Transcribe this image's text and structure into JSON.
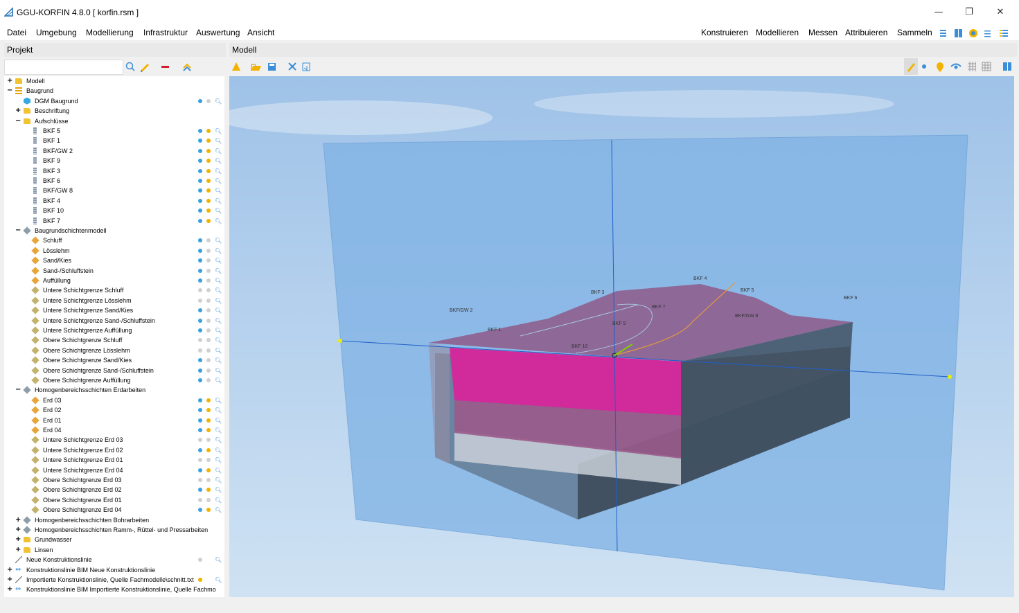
{
  "window": {
    "title": "GGU-KORFIN 4.8.0 [ korfin.rsm ]",
    "minimize": "—",
    "restore": "❐",
    "close": "✕",
    "accent": "#3a8fd8"
  },
  "menu": {
    "left": [
      "Datei",
      "Umgebung",
      "Modellierung",
      "Infrastruktur",
      "Auswertung",
      "Ansicht"
    ],
    "right": [
      "Konstruieren",
      "Modellieren",
      "Messen",
      "Attribuieren",
      "Sammeln"
    ]
  },
  "project_panel": {
    "title": "Projekt",
    "tools": [
      "search-icon",
      "pencil-icon",
      "remove-icon",
      "collapse-icon"
    ]
  },
  "model_panel": {
    "title": "Modell",
    "left_tools": [
      "warning-icon",
      "open-folder-icon",
      "save-icon",
      "tools-icon",
      "import-icon"
    ],
    "right_tools": [
      "pick-icon",
      "point-icon",
      "pin-icon",
      "eye-icon",
      "grid-icon",
      "table-icon",
      "panel-icon"
    ]
  },
  "tree": [
    {
      "level": 0,
      "exp": "+",
      "icon": "folder",
      "label": "Modell",
      "dots": []
    },
    {
      "level": 0,
      "exp": "−",
      "icon": "list",
      "label": "Baugrund",
      "dots": []
    },
    {
      "level": 1,
      "exp": "",
      "icon": "dgm",
      "label": "DGM Baugrund",
      "dots": [
        "b",
        "g"
      ],
      "mag": true
    },
    {
      "level": 1,
      "exp": "+",
      "icon": "folder",
      "label": "Beschriftung",
      "dots": []
    },
    {
      "level": 1,
      "exp": "−",
      "icon": "folder",
      "label": "Aufschlüsse",
      "dots": []
    },
    {
      "level": 2,
      "exp": "",
      "icon": "bore",
      "label": "BKF 5",
      "dots": [
        "b",
        "o"
      ],
      "mag": true
    },
    {
      "level": 2,
      "exp": "",
      "icon": "bore",
      "label": "BKF 1",
      "dots": [
        "b",
        "o"
      ],
      "mag": true
    },
    {
      "level": 2,
      "exp": "",
      "icon": "bore",
      "label": "BKF/GW 2",
      "dots": [
        "b",
        "o"
      ],
      "mag": true
    },
    {
      "level": 2,
      "exp": "",
      "icon": "bore",
      "label": "BKF 9",
      "dots": [
        "b",
        "o"
      ],
      "mag": true
    },
    {
      "level": 2,
      "exp": "",
      "icon": "bore",
      "label": "BKF 3",
      "dots": [
        "b",
        "o"
      ],
      "mag": true
    },
    {
      "level": 2,
      "exp": "",
      "icon": "bore",
      "label": "BKF 6",
      "dots": [
        "b",
        "o"
      ],
      "mag": true
    },
    {
      "level": 2,
      "exp": "",
      "icon": "bore",
      "label": "BKF/GW 8",
      "dots": [
        "b",
        "o"
      ],
      "mag": true
    },
    {
      "level": 2,
      "exp": "",
      "icon": "bore",
      "label": "BKF 4",
      "dots": [
        "b",
        "o"
      ],
      "mag": true
    },
    {
      "level": 2,
      "exp": "",
      "icon": "bore",
      "label": "BKF 10",
      "dots": [
        "b",
        "o"
      ],
      "mag": true
    },
    {
      "level": 2,
      "exp": "",
      "icon": "bore",
      "label": "BKF 7",
      "dots": [
        "b",
        "o"
      ],
      "mag": true
    },
    {
      "level": 1,
      "exp": "−",
      "icon": "model",
      "label": "Baugrundschichtenmodell",
      "dots": []
    },
    {
      "level": 2,
      "exp": "",
      "icon": "layer",
      "label": "Schluff",
      "dots": [
        "b",
        "g"
      ],
      "mag": true
    },
    {
      "level": 2,
      "exp": "",
      "icon": "layer",
      "label": "Lösslehm",
      "dots": [
        "b",
        "g"
      ],
      "mag": true
    },
    {
      "level": 2,
      "exp": "",
      "icon": "layer",
      "label": "Sand/Kies",
      "dots": [
        "b",
        "g"
      ],
      "mag": true
    },
    {
      "level": 2,
      "exp": "",
      "icon": "layer",
      "label": "Sand-/Schluffstein",
      "dots": [
        "b",
        "g"
      ],
      "mag": true
    },
    {
      "level": 2,
      "exp": "",
      "icon": "layer",
      "label": "Auffüllung",
      "dots": [
        "b",
        "g"
      ],
      "mag": true
    },
    {
      "level": 2,
      "exp": "",
      "icon": "layer grey",
      "label": "Untere Schichtgrenze Schluff",
      "dots": [
        "g",
        "g"
      ],
      "mag": true
    },
    {
      "level": 2,
      "exp": "",
      "icon": "layer grey",
      "label": "Untere Schichtgrenze Lösslehm",
      "dots": [
        "g",
        "g"
      ],
      "mag": true
    },
    {
      "level": 2,
      "exp": "",
      "icon": "layer grey",
      "label": "Untere Schichtgrenze Sand/Kies",
      "dots": [
        "b",
        "g"
      ],
      "mag": true
    },
    {
      "level": 2,
      "exp": "",
      "icon": "layer grey",
      "label": "Untere Schichtgrenze Sand-/Schluffstein",
      "dots": [
        "b",
        "g"
      ],
      "mag": true
    },
    {
      "level": 2,
      "exp": "",
      "icon": "layer grey",
      "label": "Untere Schichtgrenze Auffüllung",
      "dots": [
        "b",
        "g"
      ],
      "mag": true
    },
    {
      "level": 2,
      "exp": "",
      "icon": "layer grey",
      "label": "Obere Schichtgrenze Schluff",
      "dots": [
        "g",
        "g"
      ],
      "mag": true
    },
    {
      "level": 2,
      "exp": "",
      "icon": "layer grey",
      "label": "Obere Schichtgrenze Lösslehm",
      "dots": [
        "g",
        "g"
      ],
      "mag": true
    },
    {
      "level": 2,
      "exp": "",
      "icon": "layer grey",
      "label": "Obere Schichtgrenze Sand/Kies",
      "dots": [
        "b",
        "g"
      ],
      "mag": true
    },
    {
      "level": 2,
      "exp": "",
      "icon": "layer grey",
      "label": "Obere Schichtgrenze Sand-/Schluffstein",
      "dots": [
        "b",
        "g"
      ],
      "mag": true
    },
    {
      "level": 2,
      "exp": "",
      "icon": "layer grey",
      "label": "Obere Schichtgrenze Auffüllung",
      "dots": [
        "b",
        "g"
      ],
      "mag": true
    },
    {
      "level": 1,
      "exp": "−",
      "icon": "model",
      "label": "Homogenbereichsschichten Erdarbeiten",
      "dots": []
    },
    {
      "level": 2,
      "exp": "",
      "icon": "layer",
      "label": "Erd 03",
      "dots": [
        "b",
        "o"
      ],
      "mag": true
    },
    {
      "level": 2,
      "exp": "",
      "icon": "layer",
      "label": "Erd 02",
      "dots": [
        "b",
        "o"
      ],
      "mag": true
    },
    {
      "level": 2,
      "exp": "",
      "icon": "layer",
      "label": "Erd 01",
      "dots": [
        "b",
        "o"
      ],
      "mag": true
    },
    {
      "level": 2,
      "exp": "",
      "icon": "layer",
      "label": "Erd 04",
      "dots": [
        "b",
        "o"
      ],
      "mag": true
    },
    {
      "level": 2,
      "exp": "",
      "icon": "layer grey",
      "label": "Untere Schichtgrenze Erd 03",
      "dots": [
        "g",
        "g"
      ],
      "mag": true
    },
    {
      "level": 2,
      "exp": "",
      "icon": "layer grey",
      "label": "Untere Schichtgrenze Erd 02",
      "dots": [
        "b",
        "o"
      ],
      "mag": true
    },
    {
      "level": 2,
      "exp": "",
      "icon": "layer grey",
      "label": "Untere Schichtgrenze Erd 01",
      "dots": [
        "g",
        "g"
      ],
      "mag": true
    },
    {
      "level": 2,
      "exp": "",
      "icon": "layer grey",
      "label": "Untere Schichtgrenze Erd 04",
      "dots": [
        "b",
        "o"
      ],
      "mag": true
    },
    {
      "level": 2,
      "exp": "",
      "icon": "layer grey",
      "label": "Obere Schichtgrenze Erd 03",
      "dots": [
        "g",
        "g"
      ],
      "mag": true
    },
    {
      "level": 2,
      "exp": "",
      "icon": "layer grey",
      "label": "Obere Schichtgrenze Erd 02",
      "dots": [
        "b",
        "o"
      ],
      "mag": true
    },
    {
      "level": 2,
      "exp": "",
      "icon": "layer grey",
      "label": "Obere Schichtgrenze Erd 01",
      "dots": [
        "g",
        "g"
      ],
      "mag": true
    },
    {
      "level": 2,
      "exp": "",
      "icon": "layer grey",
      "label": "Obere Schichtgrenze Erd 04",
      "dots": [
        "b",
        "o"
      ],
      "mag": true
    },
    {
      "level": 1,
      "exp": "+",
      "icon": "model",
      "label": "Homogenbereichsschichten Bohrarbeiten",
      "dots": []
    },
    {
      "level": 1,
      "exp": "+",
      "icon": "model",
      "label": "Homogenbereichsschichten Ramm-, Rüttel- und Pressarbeiten",
      "dots": []
    },
    {
      "level": 1,
      "exp": "+",
      "icon": "folder",
      "label": "Grundwasser",
      "dots": []
    },
    {
      "level": 1,
      "exp": "+",
      "icon": "folder",
      "label": "Linsen",
      "dots": []
    },
    {
      "level": 0,
      "exp": "",
      "icon": "line",
      "label": "Neue Konstruktionslinie",
      "dots": [
        "g"
      ],
      "mag": true
    },
    {
      "level": 0,
      "exp": "+",
      "icon": "bim",
      "label": "Konstruktionslinie BIM Neue Konstruktionslinie",
      "dots": []
    },
    {
      "level": 0,
      "exp": "+",
      "icon": "line",
      "label": "Importierte Konstruktionslinie, Quelle Fachmodelle\\schnitt.txt",
      "dots": [
        "o"
      ],
      "mag": true
    },
    {
      "level": 0,
      "exp": "+",
      "icon": "bim",
      "label": "Konstruktionslinie BIM Importierte Konstruktionslinie, Quelle Fachmo",
      "dots": []
    }
  ],
  "scene_labels": [
    "BKF/GW 2",
    "BKF 1",
    "BKF 3",
    "BKF 9",
    "BKF 7",
    "BKF 4",
    "BKF 5",
    "BKF/GW 8",
    "BKF 6",
    "BKF 10"
  ],
  "colors": {
    "section_plane": "#7fb2e5",
    "magenta_face": "#d12a9a",
    "terrain": "#8e5f8e"
  }
}
